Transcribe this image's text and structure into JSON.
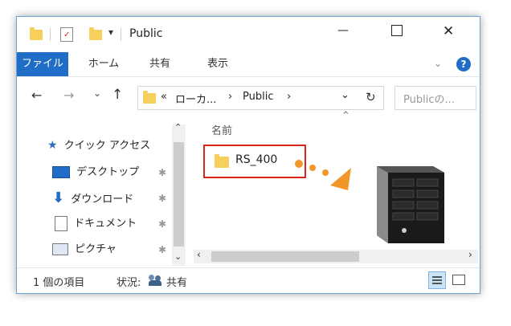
{
  "window": {
    "title": "Public",
    "controls": {
      "minimize": "—",
      "maximize": "☐",
      "close": "✕"
    }
  },
  "ribbon": {
    "tabs": [
      {
        "label": "ファイル"
      },
      {
        "label": "ホーム"
      },
      {
        "label": "共有"
      },
      {
        "label": "表示"
      }
    ],
    "expand_icon": "chevron-down-icon",
    "help_label": "?"
  },
  "addressbar": {
    "back": "←",
    "forward": "→",
    "recent": "⌄",
    "up": "↑",
    "overflow": "«",
    "crumbs": [
      "ローカ...",
      "Public"
    ],
    "crumb_sep": "›",
    "dropdown": "⌄",
    "refresh": "↻",
    "search_placeholder": "Publicの..."
  },
  "navpane": {
    "items": [
      {
        "label": "クイック アクセス",
        "icon": "star-icon"
      },
      {
        "label": "デスクトップ",
        "icon": "desktop-icon"
      },
      {
        "label": "ダウンロード",
        "icon": "download-icon"
      },
      {
        "label": "ドキュメント",
        "icon": "document-icon"
      },
      {
        "label": "ピクチャ",
        "icon": "picture-icon"
      }
    ]
  },
  "content": {
    "column_header": "名前",
    "items": [
      {
        "name": "RS_400",
        "type": "folder"
      }
    ]
  },
  "status": {
    "count": "1 個の項目",
    "state_label": "状況:",
    "state_value": "共有"
  },
  "colors": {
    "accent": "#1f6dc6",
    "highlight_box": "#d9261c",
    "arrow": "#f0962a",
    "folder": "#f7cf5c"
  }
}
